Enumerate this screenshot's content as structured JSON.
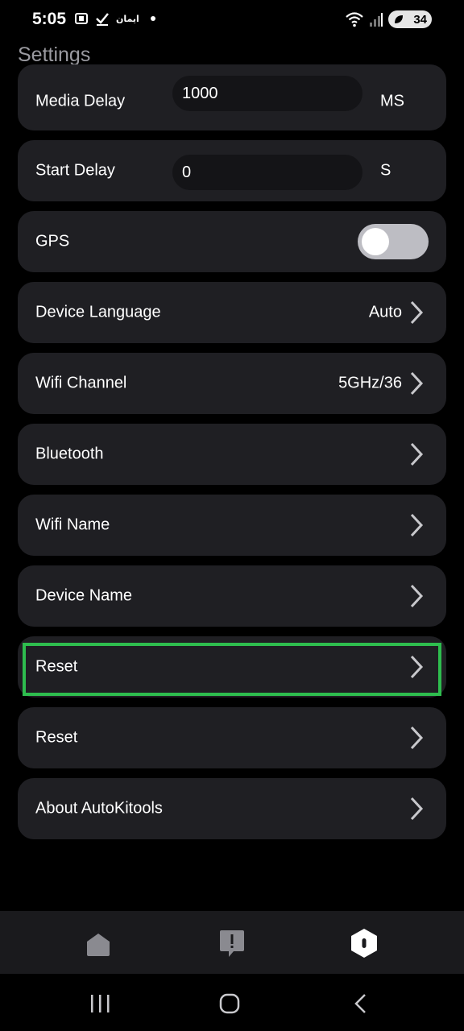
{
  "status_bar": {
    "time": "5:05",
    "carrier_text": "ايمان",
    "battery": "34"
  },
  "page": {
    "title": "Settings"
  },
  "settings": {
    "media_delay": {
      "label": "Media Delay",
      "value": "1000",
      "unit": "MS"
    },
    "start_delay": {
      "label": "Start Delay",
      "value": "0",
      "unit": "S"
    },
    "gps": {
      "label": "GPS",
      "enabled": false
    },
    "device_language": {
      "label": "Device Language",
      "value": "Auto"
    },
    "wifi_channel": {
      "label": "Wifi Channel",
      "value": "5GHz/36"
    },
    "bluetooth": {
      "label": "Bluetooth"
    },
    "wifi_name": {
      "label": "Wifi Name"
    },
    "device_name": {
      "label": "Device Name"
    },
    "reset_1": {
      "label": "Reset"
    },
    "reset_2": {
      "label": "Reset"
    },
    "about": {
      "label": "About AutoKitools"
    }
  },
  "colors": {
    "background": "#000000",
    "row_background": "#1f1f23",
    "highlight": "#2ebd4e",
    "title": "#9a9aa0"
  },
  "tab_bar": {
    "tabs": [
      "home-icon",
      "feedback-icon",
      "settings-icon"
    ],
    "active": "settings-icon"
  }
}
